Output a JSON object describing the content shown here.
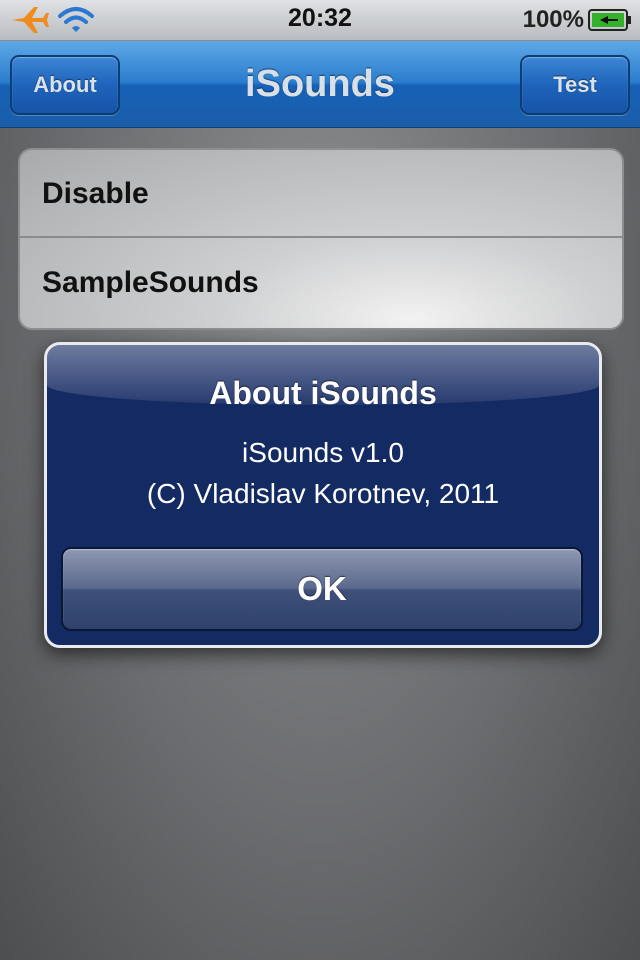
{
  "status_bar": {
    "time": "20:32",
    "battery_percent": "100%",
    "icons": [
      "airplane-icon",
      "wifi-icon",
      "battery-charging-icon"
    ]
  },
  "nav_bar": {
    "title": "iSounds",
    "left_button": "About",
    "right_button": "Test",
    "accent_color": "#1f6ac0"
  },
  "list": {
    "items": [
      {
        "label": "Disable"
      },
      {
        "label": "SampleSounds"
      }
    ]
  },
  "alert": {
    "title": "About iSounds",
    "lines": [
      "iSounds v1.0",
      "(C) Vladislav Korotnev, 2011"
    ],
    "button": "OK",
    "background_color": "#142a63"
  }
}
